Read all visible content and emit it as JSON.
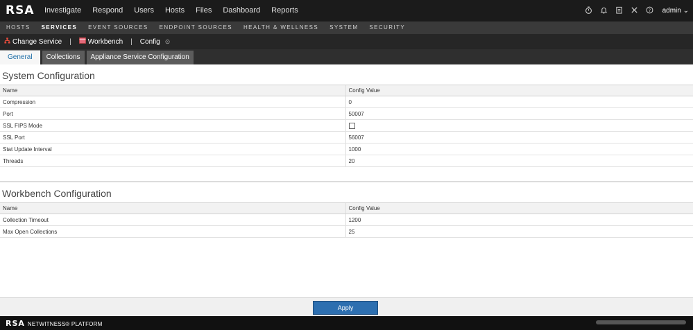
{
  "app": {
    "logo": "RSA"
  },
  "nav": [
    "Investigate",
    "Respond",
    "Users",
    "Hosts",
    "Files",
    "Dashboard",
    "Reports"
  ],
  "top_icons": [
    "timer-icon",
    "bell-icon",
    "clipboard-icon",
    "tools-icon",
    "help-icon"
  ],
  "user": {
    "name": "admin",
    "chevron": "⌄"
  },
  "subnav": [
    "HOSTS",
    "SERVICES",
    "EVENT SOURCES",
    "ENDPOINT SOURCES",
    "HEALTH & WELLNESS",
    "SYSTEM",
    "SECURITY"
  ],
  "subnav_active": "SERVICES",
  "toolbar": {
    "change_service": "Change Service",
    "workbench": "Workbench",
    "config": "Config",
    "sep": "|",
    "config_caret": "⊙"
  },
  "tabs": [
    "General",
    "Collections",
    "Appliance Service Configuration"
  ],
  "tab_active": "General",
  "system_config": {
    "title": "System Configuration",
    "col_name": "Name",
    "col_value": "Config Value",
    "rows": [
      {
        "name": "Compression",
        "value": "0"
      },
      {
        "name": "Port",
        "value": "50007"
      },
      {
        "name": "SSL FIPS Mode",
        "value": "",
        "checkbox": true
      },
      {
        "name": "SSL Port",
        "value": "56007"
      },
      {
        "name": "Stat Update Interval",
        "value": "1000"
      },
      {
        "name": "Threads",
        "value": "20"
      }
    ]
  },
  "workbench_config": {
    "title": "Workbench Configuration",
    "col_name": "Name",
    "col_value": "Config Value",
    "rows": [
      {
        "name": "Collection Timeout",
        "value": "1200"
      },
      {
        "name": "Max Open Collections",
        "value": "25"
      }
    ]
  },
  "footer": {
    "apply_label": "Apply"
  },
  "status_bar": {
    "brand": "RSA",
    "platform": "NETWITNESS® PLATFORM"
  },
  "colors": {
    "accent": "#2d6fb0",
    "topbar": "#1b1b1b",
    "tab_active_text": "#1f6fa8"
  }
}
